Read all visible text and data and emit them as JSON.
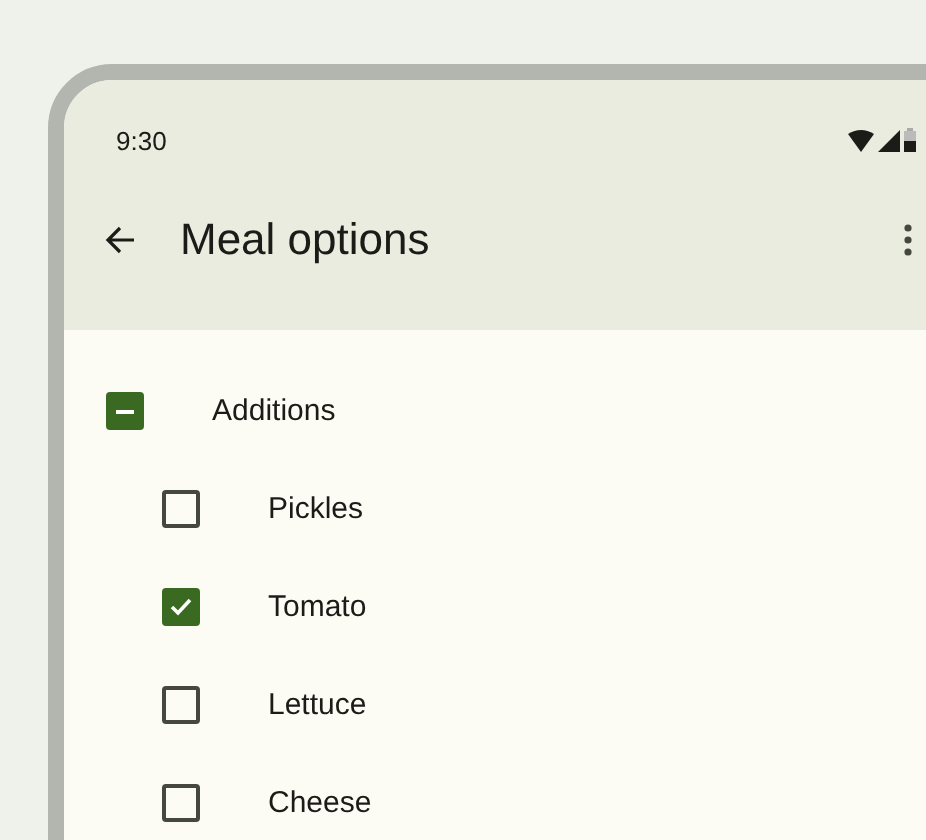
{
  "status_bar": {
    "time": "9:30"
  },
  "toolbar": {
    "title": "Meal options"
  },
  "group": {
    "label": "Additions",
    "indeterminate": true,
    "children": [
      {
        "label": "Pickles",
        "checked": false
      },
      {
        "label": "Tomato",
        "checked": true
      },
      {
        "label": "Lettuce",
        "checked": false
      },
      {
        "label": "Cheese",
        "checked": false
      }
    ]
  }
}
